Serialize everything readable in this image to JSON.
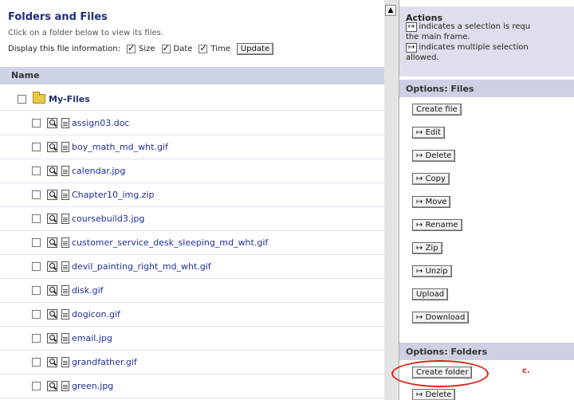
{
  "left": {
    "title": "Folders and Files",
    "subtitle": "Click on a folder below to view its files.",
    "display_label": "Display this file information:",
    "options": [
      {
        "label": "Size",
        "checked": true
      },
      {
        "label": "Date",
        "checked": true
      },
      {
        "label": "Time",
        "checked": true
      }
    ],
    "update_label": "Update",
    "column_header": "Name",
    "root_folder": "My-Files",
    "files": [
      "assign03.doc",
      "boy_math_md_wht.gif",
      "calendar.jpg",
      "Chapter10_img.zip",
      "coursebuild3.jpg",
      "customer_service_desk_sleeping_md_wht.gif",
      "devil_painting_right_md_wht.gif",
      "disk.gif",
      "dogicon.gif",
      "email.jpg",
      "grandfather.gif",
      "green.jpg"
    ]
  },
  "scrollbar": {
    "up_arrow": "▲"
  },
  "right": {
    "actions_title": "Actions",
    "actions_line1": "indicates a selection is requ",
    "actions_line2": "the main frame.",
    "actions_line3": "indicates multiple selection",
    "actions_line4": "allowed.",
    "single_marker": "↦",
    "multi_marker": "↦",
    "files_header": "Options: Files",
    "file_buttons": [
      {
        "label": "Create file",
        "marker": ""
      },
      {
        "label": "Edit",
        "marker": "↦"
      },
      {
        "label": "Delete",
        "marker": "↦"
      },
      {
        "label": "Copy",
        "marker": "↦"
      },
      {
        "label": "Move",
        "marker": "↦"
      },
      {
        "label": "Rename",
        "marker": "↦"
      },
      {
        "label": "Zip",
        "marker": "↦"
      },
      {
        "label": "Unzip",
        "marker": "↦"
      },
      {
        "label": "Upload",
        "marker": ""
      },
      {
        "label": "Download",
        "marker": "↦"
      }
    ],
    "folders_header": "Options: Folders",
    "folder_buttons": [
      {
        "label": "Create folder",
        "marker": ""
      },
      {
        "label": "Delete",
        "marker": "↦"
      }
    ]
  },
  "callout_letter": "c.",
  "highlight_color": "#e0201a"
}
